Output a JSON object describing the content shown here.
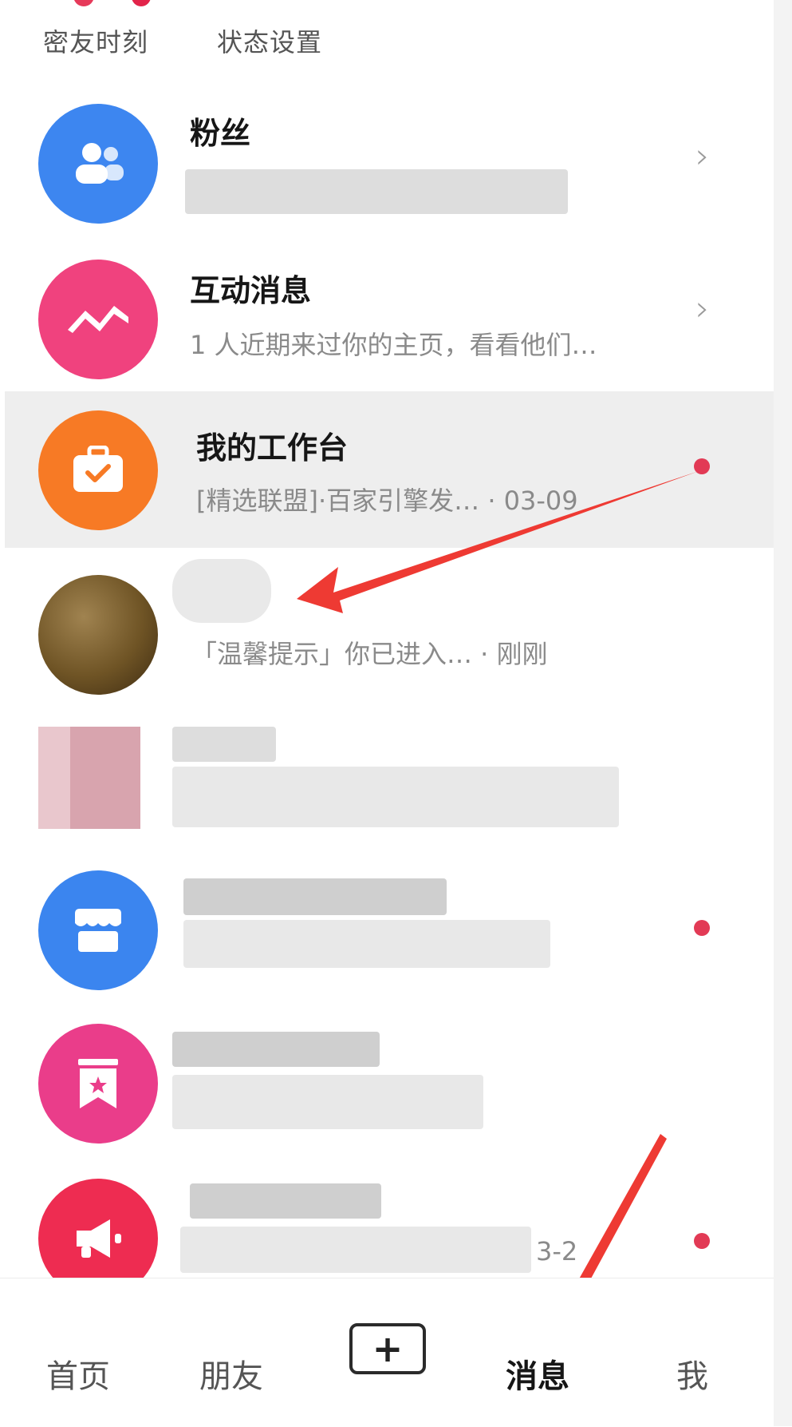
{
  "top_links": [
    {
      "label": "密友时刻"
    },
    {
      "label": "状态设置"
    }
  ],
  "rows": [
    {
      "title": "粉丝",
      "subtitle": "",
      "icon": "fans-icon",
      "color": "#3d86f0",
      "has_chevron": true
    },
    {
      "title": "互动消息",
      "subtitle": "1 人近期来过你的主页，看看他们…",
      "icon": "interaction-icon",
      "color": "#f0427e",
      "has_chevron": true
    },
    {
      "title": "我的工作台",
      "subtitle": "[精选联盟]·百家引擎发… · 03-09",
      "icon": "briefcase-icon",
      "color": "#f77a25",
      "unread": true
    },
    {
      "title": "",
      "subtitle": "「温馨提示」你已进入… · 刚刚",
      "icon": "avatar-photo"
    },
    {
      "title": "",
      "subtitle": "",
      "icon": "avatar-blurred"
    },
    {
      "title": "",
      "subtitle": "",
      "icon": "store-icon",
      "color": "#3b85ef",
      "unread": true
    },
    {
      "title": "",
      "subtitle": "",
      "icon": "bookmark-star-icon",
      "color": "#ea3d8a"
    },
    {
      "title": "",
      "subtitle": "3-2",
      "icon": "megaphone-icon",
      "color": "#ee2c51",
      "unread": true
    }
  ],
  "bottom_nav": {
    "home": "首页",
    "friends": "朋友",
    "create": "+",
    "messages": "消息",
    "me": "我",
    "active": "messages"
  },
  "colors": {
    "accent_red": "#e23a55",
    "arrow_red": "#ee3a33"
  }
}
